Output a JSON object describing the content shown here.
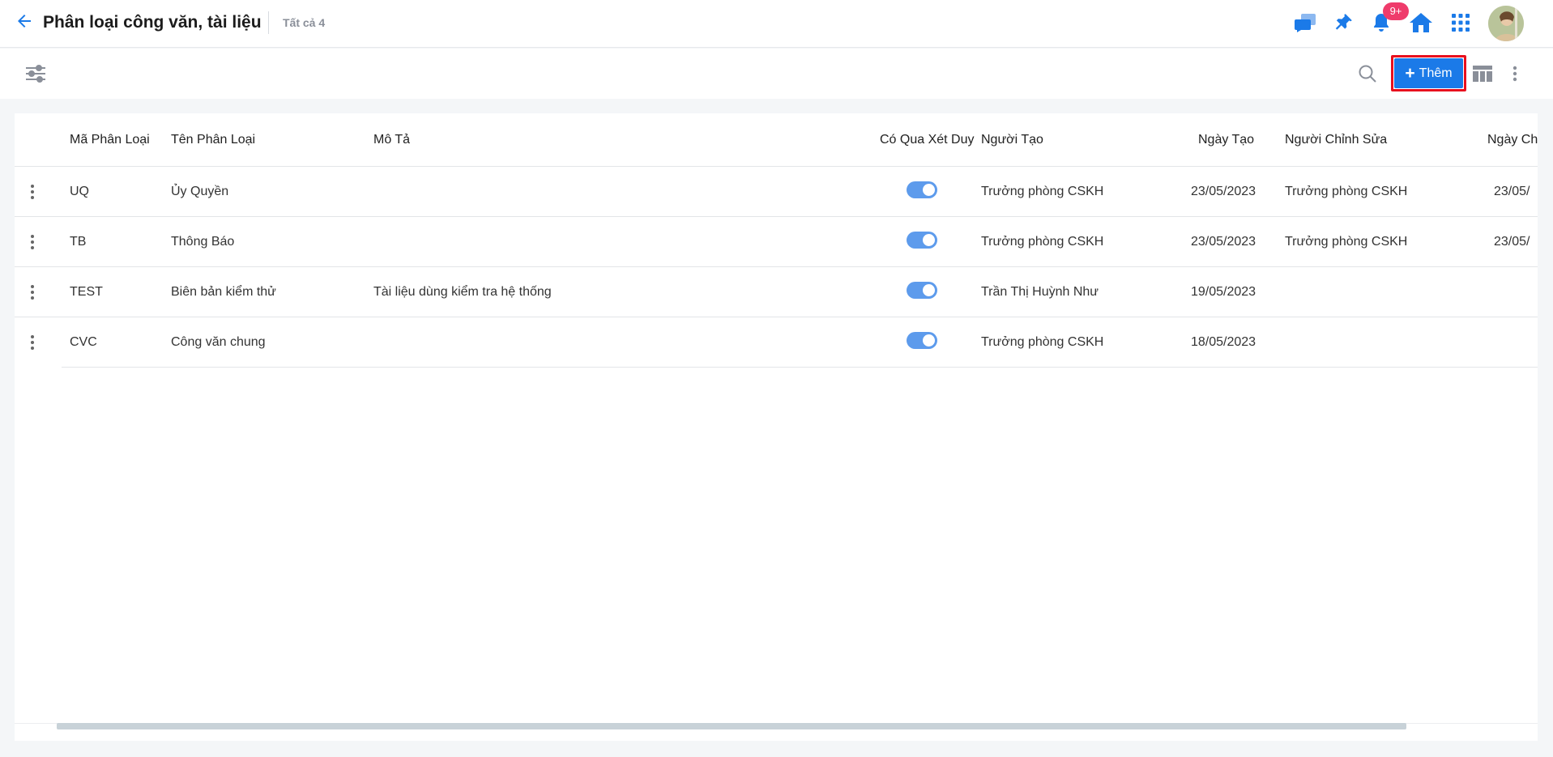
{
  "header": {
    "title": "Phân loại công văn, tài liệu",
    "count_label": "Tất cả 4",
    "notification_badge": "9+",
    "icons": [
      "back-arrow-icon",
      "chat-icon",
      "pin-icon",
      "bell-icon",
      "home-icon",
      "apps-grid-icon",
      "avatar"
    ]
  },
  "toolbar": {
    "add_label": "Thêm",
    "icons": [
      "filter-sliders-icon",
      "search-icon",
      "table-layout-icon",
      "more-vertical-icon"
    ]
  },
  "colors": {
    "primary": "#1b7ae8",
    "badge": "#ef3b6b",
    "toggle_on": "#5d9bec",
    "highlight_outline": "#e8101e"
  },
  "table": {
    "columns": [
      "Mã Phân Loại",
      "Tên Phân Loại",
      "Mô Tả",
      "Có Qua Xét Duy",
      "Người Tạo",
      "Ngày Tạo",
      "Người Chỉnh Sửa",
      "Ngày Ch"
    ],
    "rows": [
      {
        "code": "UQ",
        "name": "Ủy Quyền",
        "desc": "",
        "approval": true,
        "creator": "Trưởng phòng CSKH",
        "created": "23/05/2023",
        "editor": "Trưởng phòng CSKH",
        "edited": "23/05/"
      },
      {
        "code": "TB",
        "name": "Thông Báo",
        "desc": "",
        "approval": true,
        "creator": "Trưởng phòng CSKH",
        "created": "23/05/2023",
        "editor": "Trưởng phòng CSKH",
        "edited": "23/05/"
      },
      {
        "code": "TEST",
        "name": "Biên bản kiểm thử",
        "desc": "Tài liệu dùng kiểm tra hệ thống",
        "approval": true,
        "creator": "Trần Thị Huỳnh Như",
        "created": "19/05/2023",
        "editor": "",
        "edited": ""
      },
      {
        "code": "CVC",
        "name": "Công văn chung",
        "desc": "",
        "approval": true,
        "creator": "Trưởng phòng CSKH",
        "created": "18/05/2023",
        "editor": "",
        "edited": ""
      }
    ]
  }
}
